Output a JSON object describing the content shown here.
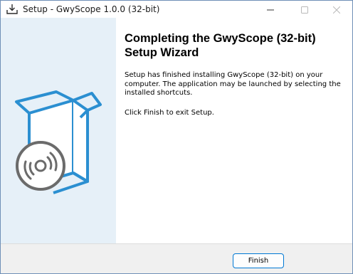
{
  "window": {
    "title": "Setup - GwyScope 1.0.0 (32-bit)"
  },
  "icons": {
    "app": "installer-download-icon",
    "minimize": "minimize-icon",
    "maximize": "maximize-icon",
    "close": "close-icon",
    "banner": "software-box-with-disc-icon"
  },
  "content": {
    "heading": "Completing the GwyScope (32-bit) Setup Wizard",
    "description": "Setup has finished installing GwyScope (32-bit) on your computer. The application may be launched by selecting the installed shortcuts.",
    "finish_note": "Click Finish to exit Setup."
  },
  "footer": {
    "finish_label": "Finish"
  },
  "colors": {
    "banner_background": "#e6f0f8",
    "art_blue": "#2b8fd1",
    "disc_gray": "#6b6b6b",
    "button_border": "#0078d4",
    "footer_background": "#f0f0f0"
  }
}
